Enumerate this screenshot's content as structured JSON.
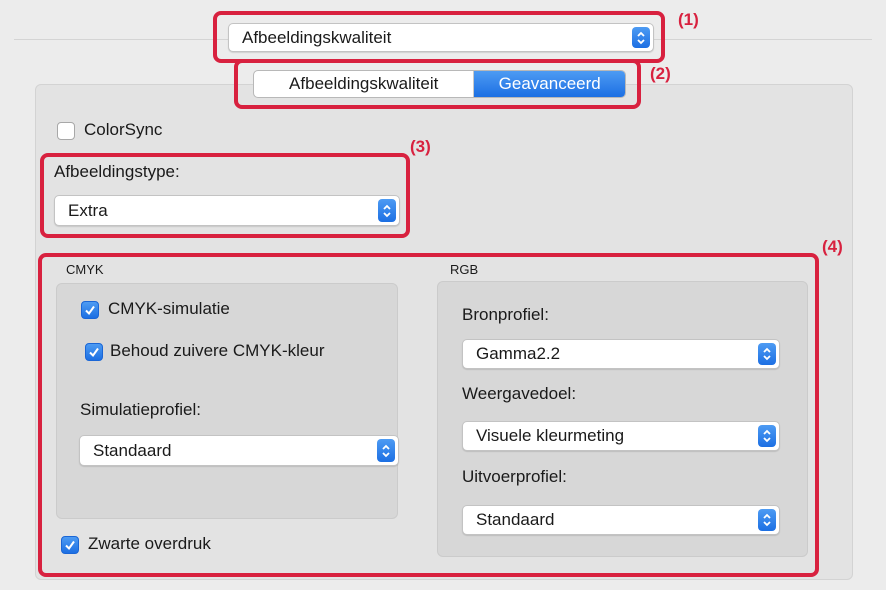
{
  "top_popup": {
    "value": "Afbeeldingskwaliteit"
  },
  "tabs": [
    {
      "label": "Afbeeldingskwaliteit",
      "selected": false
    },
    {
      "label": "Geavanceerd",
      "selected": true
    }
  ],
  "colorsync": {
    "label": "ColorSync",
    "checked": false
  },
  "image_type": {
    "label": "Afbeeldingstype:",
    "value": "Extra"
  },
  "cmyk": {
    "heading": "CMYK",
    "simulation": {
      "label": "CMYK-simulatie",
      "checked": true
    },
    "preserve_pure": {
      "label": "Behoud zuivere CMYK-kleur",
      "checked": true
    },
    "profile_label": "Simulatieprofiel:",
    "profile_value": "Standaard"
  },
  "black_overprint": {
    "label": "Zwarte overdruk",
    "checked": true
  },
  "rgb": {
    "heading": "RGB",
    "source_label": "Bronprofiel:",
    "source_value": "Gamma2.2",
    "intent_label": "Weergavedoel:",
    "intent_value": "Visuele kleurmeting",
    "output_label": "Uitvoerprofiel:",
    "output_value": "Standaard"
  },
  "callouts": [
    "(1)",
    "(2)",
    "(3)",
    "(4)"
  ],
  "colors": {
    "accent": "#1c6fe3",
    "annotation": "#d8213f"
  }
}
